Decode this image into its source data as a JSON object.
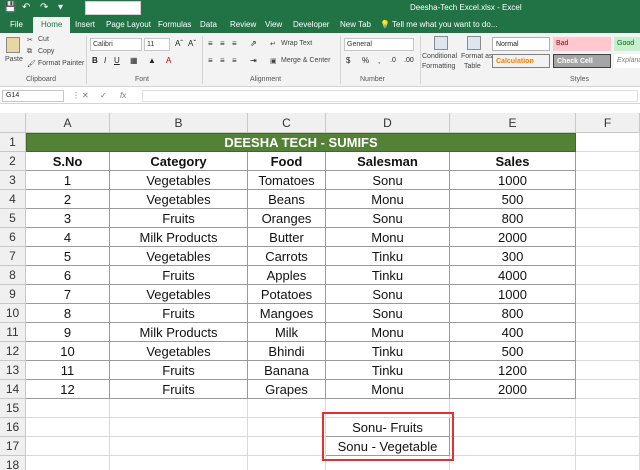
{
  "titlebar": {
    "title": "Deesha-Tech Excel.xlsx - Excel"
  },
  "tabs": [
    "File",
    "Home",
    "Insert",
    "Page Layout",
    "Formulas",
    "Data",
    "Review",
    "View",
    "Developer",
    "New Tab"
  ],
  "active_tab": "Home",
  "tell_me": "Tell me what you want to do...",
  "ribbon": {
    "clipboard": {
      "paste": "Paste",
      "cut": "Cut",
      "copy": "Copy",
      "format_painter": "Format Painter",
      "label": "Clipboard"
    },
    "font": {
      "name": "Calibri",
      "size": "11",
      "label": "Font"
    },
    "alignment": {
      "wrap_text": "Wrap Text",
      "merge_center": "Merge & Center",
      "label": "Alignment"
    },
    "number": {
      "format": "General",
      "label": "Number"
    },
    "styles": {
      "conditional": "Conditional",
      "formatting": "Formatting",
      "format_as": "Format as",
      "table": "Table",
      "normal": "Normal",
      "bad": "Bad",
      "good": "Good",
      "calculation": "Calculation",
      "check_cell": "Check Cell",
      "explanatory": "Explana",
      "label": "Styles"
    }
  },
  "formula_bar": {
    "name_box": "G14",
    "fx": "fx"
  },
  "columns": [
    "A",
    "B",
    "C",
    "D",
    "E",
    "F"
  ],
  "rows": [
    "1",
    "2",
    "3",
    "4",
    "5",
    "6",
    "7",
    "8",
    "9",
    "10",
    "11",
    "12",
    "13",
    "14",
    "15",
    "16",
    "17",
    "18"
  ],
  "sheet": {
    "title": "DEESHA TECH - SUMIFS",
    "headers": [
      "S.No",
      "Category",
      "Food",
      "Salesman",
      "Sales"
    ],
    "data": [
      [
        "1",
        "Vegetables",
        "Tomatoes",
        "Sonu",
        "1000"
      ],
      [
        "2",
        "Vegetables",
        "Beans",
        "Monu",
        "500"
      ],
      [
        "3",
        "Fruits",
        "Oranges",
        "Sonu",
        "800"
      ],
      [
        "4",
        "Milk Products",
        "Butter",
        "Monu",
        "2000"
      ],
      [
        "5",
        "Vegetables",
        "Carrots",
        "Tinku",
        "300"
      ],
      [
        "6",
        "Fruits",
        "Apples",
        "Tinku",
        "4000"
      ],
      [
        "7",
        "Vegetables",
        "Potatoes",
        "Sonu",
        "1000"
      ],
      [
        "8",
        "Fruits",
        "Mangoes",
        "Sonu",
        "800"
      ],
      [
        "9",
        "Milk Products",
        "Milk",
        "Monu",
        "400"
      ],
      [
        "10",
        "Vegetables",
        "Bhindi",
        "Tinku",
        "500"
      ],
      [
        "11",
        "Fruits",
        "Banana",
        "Tinku",
        "1200"
      ],
      [
        "12",
        "Fruits",
        "Grapes",
        "Monu",
        "2000"
      ]
    ],
    "criteria": [
      "Sonu- Fruits",
      "Sonu - Vegetable"
    ]
  },
  "colors": {
    "excel_green": "#217346",
    "title_fill": "#538135",
    "highlight_border": "#e03030"
  }
}
